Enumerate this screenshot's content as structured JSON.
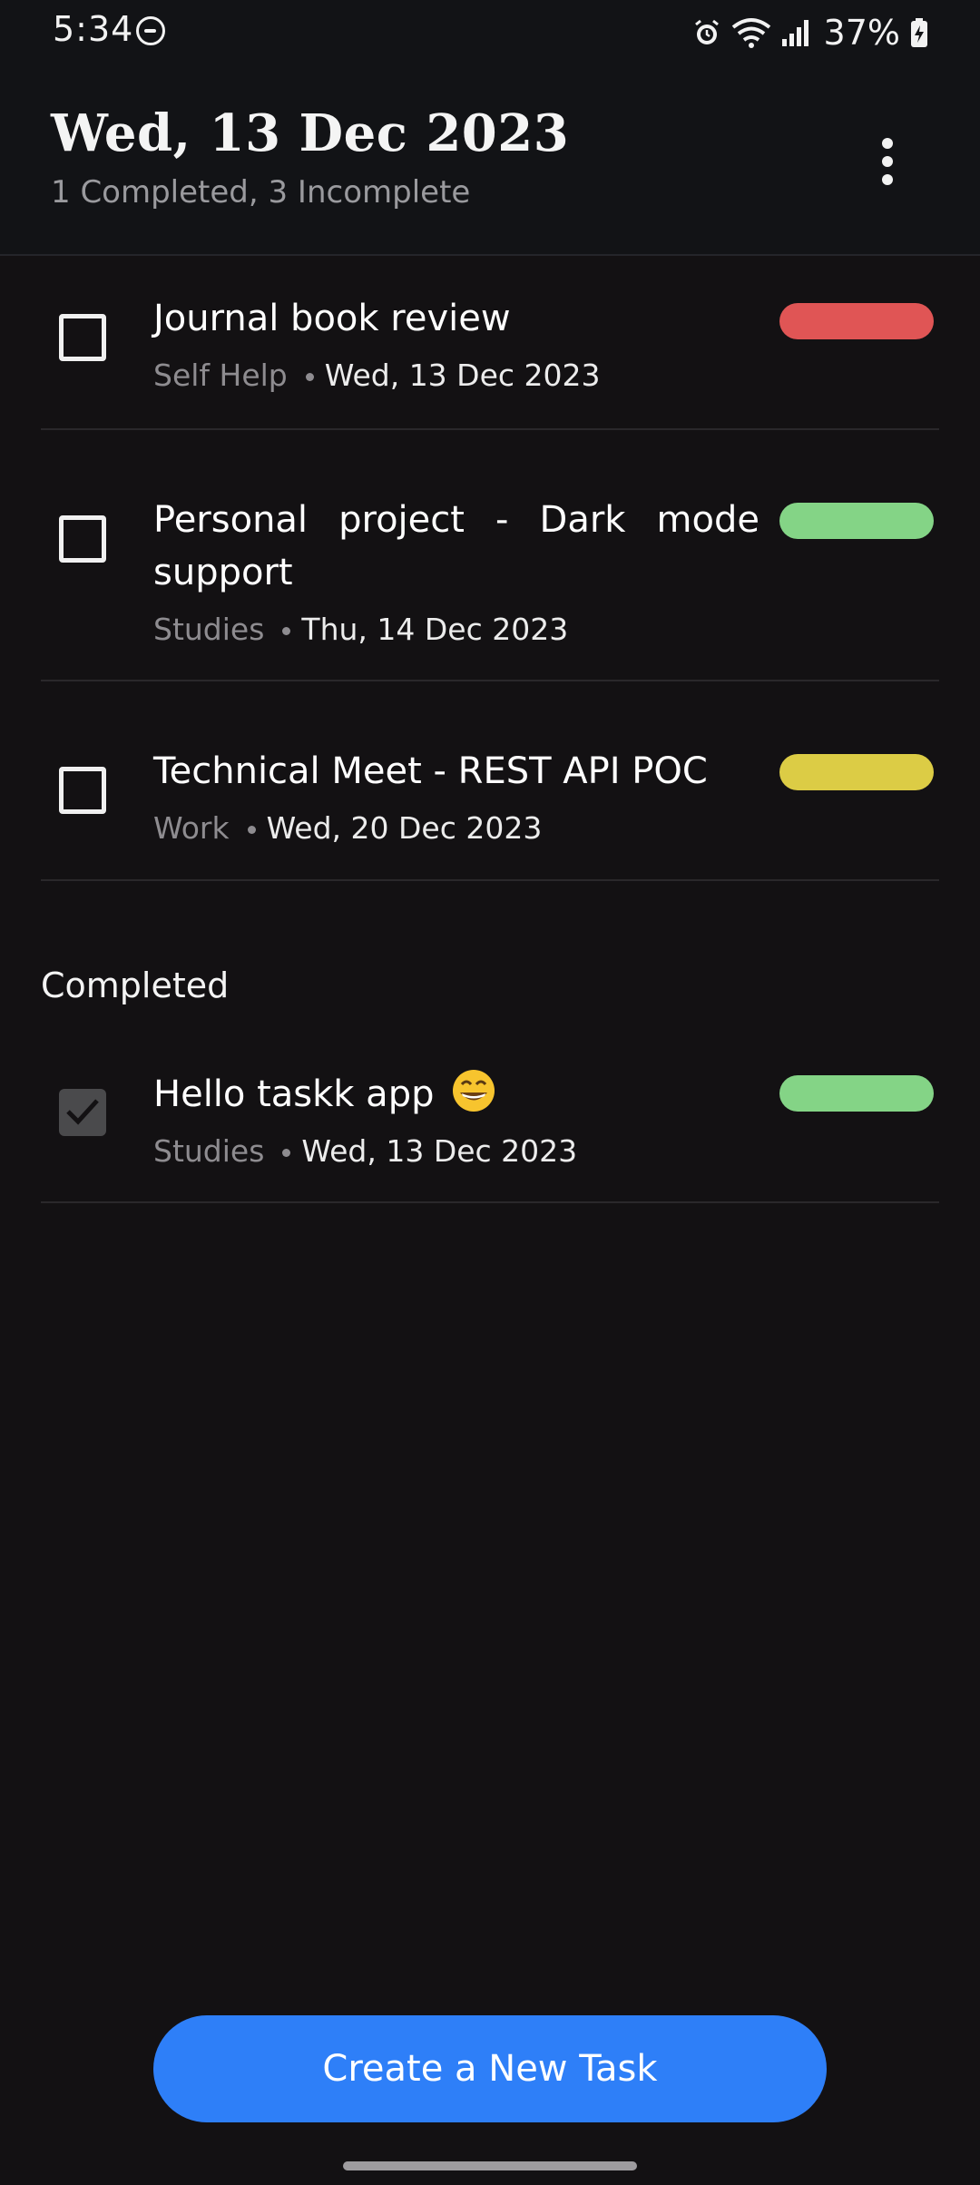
{
  "status_bar": {
    "time": "5:34",
    "battery": "37%"
  },
  "header": {
    "title": "Wed, 13 Dec 2023",
    "subtitle": "1 Completed, 3 Incomplete"
  },
  "tasks_incomplete": [
    {
      "title": "Journal book review",
      "category": "Self Help",
      "date": "Wed, 13 Dec 2023",
      "priority_color": "#e05555"
    },
    {
      "title": "Personal project - Dark mode support",
      "category": "Studies",
      "date": "Thu, 14 Dec 2023",
      "priority_color": "#84d486"
    },
    {
      "title": "Technical Meet - REST API POC",
      "category": "Work",
      "date": "Wed, 20 Dec 2023",
      "priority_color": "#dccc45"
    }
  ],
  "completed_section": {
    "heading": "Completed",
    "tasks": [
      {
        "title": "Hello taskk app",
        "emoji": "grinning-face-emoji",
        "category": "Studies",
        "date": "Wed, 13 Dec 2023",
        "priority_color": "#84d486"
      }
    ]
  },
  "actions": {
    "create_label": "Create a New Task"
  },
  "colors": {
    "background": "#131113",
    "header_background": "#121316",
    "accent": "#2e7ff8"
  }
}
